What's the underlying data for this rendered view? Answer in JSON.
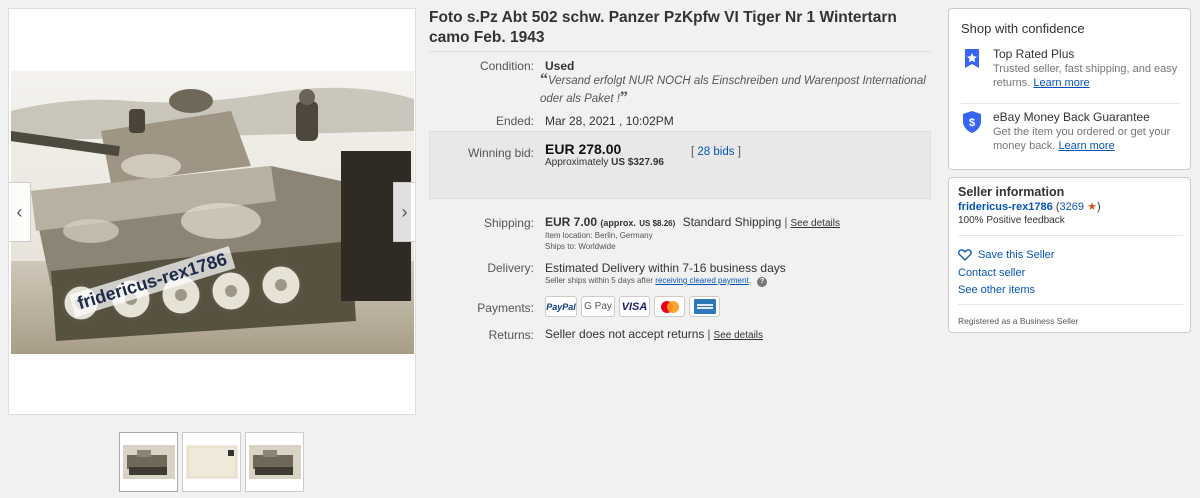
{
  "item": {
    "title": "Foto s.Pz Abt 502 schw. Panzer PzKpfw VI Tiger Nr 1 Wintertarn camo Feb. 1943",
    "watermark": "fridericus-rex1786"
  },
  "details": {
    "condition_label": "Condition:",
    "condition_value": "Used",
    "condition_open_quote": "“",
    "condition_description": "Versand erfolgt NUR NOCH als Einschreiben und Warenpost International oder als Paket !",
    "condition_close_quote": "”",
    "ended_label": "Ended:",
    "ended_value": "Mar 28, 2021 , 10:02PM",
    "winning_label": "Winning bid:",
    "winning_price": "EUR 278.00",
    "approx_prefix": "Approximately",
    "approx_value": "US $327.96",
    "bids_open": "[",
    "bids_link": "28 bids",
    "bids_close": "]",
    "shipping_label": "Shipping:",
    "shipping_price": "EUR 7.00",
    "shipping_approx": "(approx.",
    "shipping_approx_value": "US $8.26)",
    "shipping_method": "Standard Shipping",
    "see_details": "See details",
    "item_location": "Item location:  Berlin, Germany",
    "ships_to": "Ships to:  Worldwide",
    "delivery_label": "Delivery:",
    "delivery_value": "Estimated Delivery within 7-16 business days",
    "delivery_note_prefix": "Seller ships within 5 days after",
    "delivery_note_link": "receiving cleared payment",
    "delivery_note_suffix": ".",
    "payments_label": "Payments:",
    "payments": [
      "PayPal",
      "G Pay",
      "VISA"
    ],
    "returns_label": "Returns:",
    "returns_value": "Seller does not accept returns",
    "returns_see_details": "See details"
  },
  "confidence": {
    "title": "Shop with confidence",
    "top_rated_title": "Top Rated Plus",
    "top_rated_desc": "Trusted seller, fast shipping, and easy returns.",
    "top_rated_link": "Learn more",
    "guarantee_title": "eBay Money Back Guarantee",
    "guarantee_desc": "Get the item you ordered or get your money back.",
    "guarantee_link": "Learn more"
  },
  "seller": {
    "title": "Seller information",
    "name": "fridericus-rex1786",
    "score_open": "(",
    "score": "3269",
    "score_close": ")",
    "feedback": "100% Positive feedback",
    "save": "Save this Seller",
    "contact": "Contact seller",
    "other_items": "See other items",
    "business": "Registered as a Business Seller"
  },
  "icons": {
    "prev": "chevron-left-icon",
    "next": "chevron-right-icon",
    "heart": "heart-icon",
    "star": "star-icon",
    "info": "info-icon",
    "shield": "shield-icon",
    "ribbon": "top-rated-ribbon-icon"
  },
  "colors": {
    "link": "#0654ba",
    "star": "#e0521f",
    "bid_box": "#e8e8e8",
    "badge_blue": "#3665f3"
  }
}
